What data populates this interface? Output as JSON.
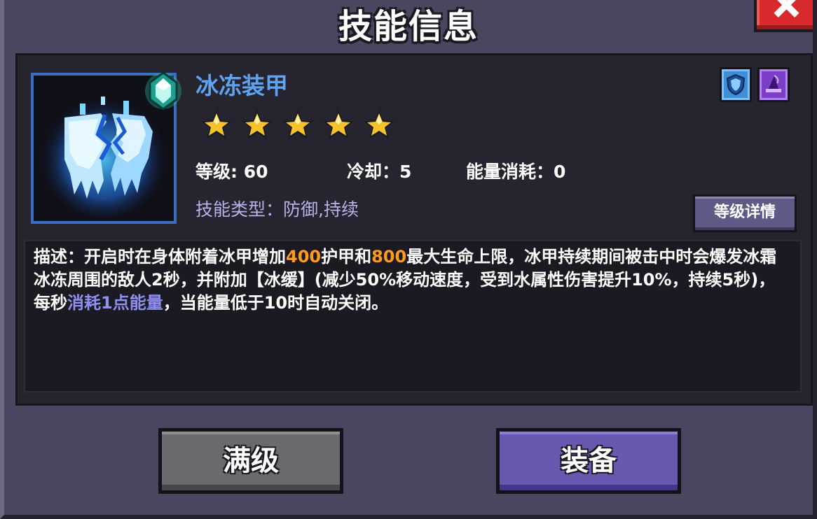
{
  "dialog": {
    "title": "技能信息"
  },
  "skill": {
    "name": "冰冻装甲",
    "stars": 5,
    "stars_max": 5,
    "level_label": "等级: 60",
    "cooldown_label": "冷却：5",
    "energy_label": "能量消耗：0",
    "type_label": "技能类型：防御,持续",
    "icon": "ice-armor-icon",
    "element_icons": [
      "shield-element-icon",
      "magic-hat-element-icon"
    ]
  },
  "buttons": {
    "detail": "等级详情",
    "max_level": "满级",
    "equip": "装备",
    "close": "close-icon"
  },
  "description": {
    "seg1": "描述：开启时在身体附着冰甲增加",
    "armor_value": "400",
    "seg2": "护甲和",
    "hp_value": "800",
    "seg3": "最大生命上限，冰甲持续期间被击中时会爆发冰霜冰冻周围的敌人2秒，并附加【冰缓】(减少50%移动速度，受到水属性伤害提升10%，持续5秒)，每秒",
    "energy_cost": "消耗1点能量",
    "seg4": "，当能量低于10时自动关闭。"
  },
  "colors": {
    "skill_name": "#5fa3f0",
    "highlight_orange": "#ff9a1f",
    "highlight_blue": "#8f8ff0",
    "close_red": "#d8292c",
    "equip_purple": "#6a57b0"
  }
}
